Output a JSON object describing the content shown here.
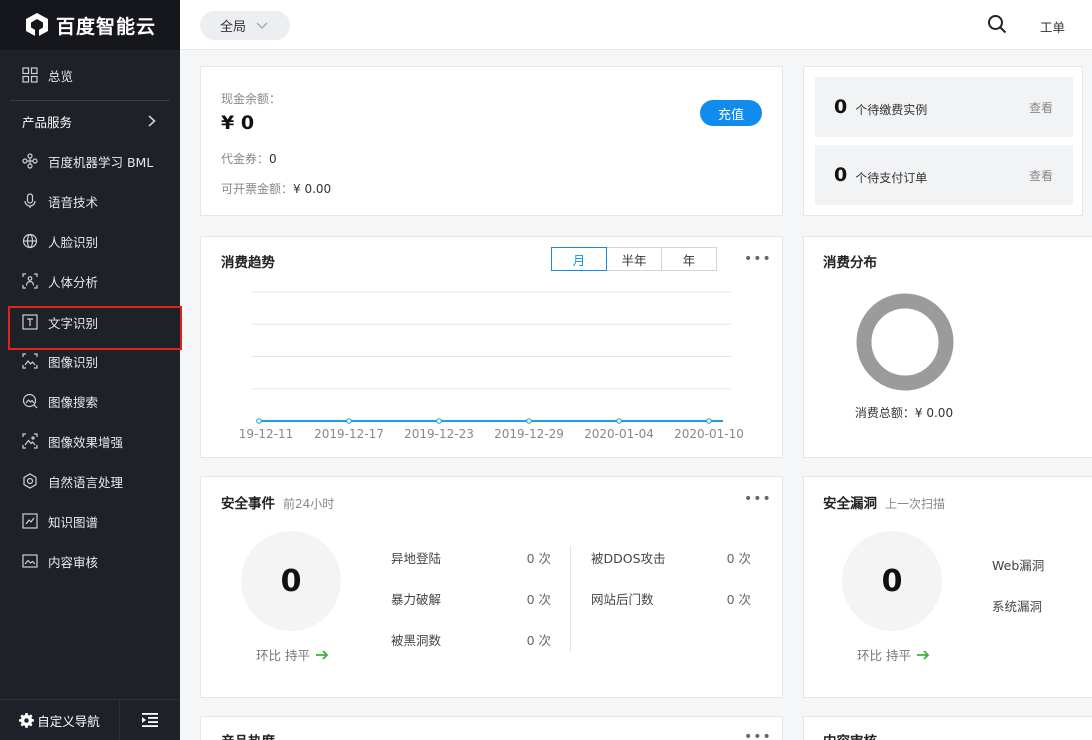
{
  "brand": {
    "name": "百度智能云"
  },
  "sidebar": {
    "overview": "总览",
    "section_label": "产品服务",
    "items": [
      {
        "label": "百度机器学习 BML"
      },
      {
        "label": "语音技术"
      },
      {
        "label": "人脸识别"
      },
      {
        "label": "人体分析"
      },
      {
        "label": "文字识别"
      },
      {
        "label": "图像识别"
      },
      {
        "label": "图像搜索"
      },
      {
        "label": "图像效果增强"
      },
      {
        "label": "自然语言处理"
      },
      {
        "label": "知识图谱"
      },
      {
        "label": "内容审核"
      }
    ],
    "custom_nav": "自定义导航"
  },
  "topbar": {
    "scope": "全局",
    "ticket": "工单"
  },
  "balance": {
    "label": "现金余额：",
    "value": "¥ 0",
    "voucher_label": "代金券：",
    "voucher_value": "0",
    "invoice_label": "可开票金额：",
    "invoice_value": "¥ 0.00",
    "recharge": "充值"
  },
  "pending": [
    {
      "count": "0",
      "text": "个待缴费实例",
      "action": "查看"
    },
    {
      "count": "0",
      "text": "个待支付订单",
      "action": "查看"
    }
  ],
  "trend": {
    "title": "消费趋势",
    "tabs": [
      "月",
      "半年",
      "年"
    ],
    "active_tab": "月",
    "more": "•••"
  },
  "chart_data": {
    "type": "line",
    "x": [
      "19-12-11",
      "2019-12-17",
      "2019-12-23",
      "2019-12-29",
      "2020-01-04",
      "2020-01-10"
    ],
    "series": [
      {
        "values": [
          0,
          0,
          0,
          0,
          0,
          0
        ]
      }
    ],
    "grid": true
  },
  "distribution": {
    "title": "消费分布",
    "total": "消费总额：¥ 0.00"
  },
  "security_events": {
    "title": "安全事件",
    "subtitle": "前24小时",
    "count": "0",
    "ratio": "环比 持平",
    "more": "•••",
    "items": [
      {
        "label": "异地登陆",
        "value": "0 次"
      },
      {
        "label": "暴力破解",
        "value": "0 次"
      },
      {
        "label": "被黑洞数",
        "value": "0 次"
      },
      {
        "label": "被DDOS攻击",
        "value": "0 次"
      },
      {
        "label": "网站后门数",
        "value": "0 次"
      }
    ]
  },
  "vulnerabilities": {
    "title": "安全漏洞",
    "subtitle": "上一次扫描",
    "count": "0",
    "ratio": "环比 持平",
    "items": [
      "Web漏洞",
      "系统漏洞"
    ]
  },
  "bottom": {
    "left_title": "产品热度",
    "right_title": "内容审核",
    "more": "•••"
  },
  "colors": {
    "sidebar_bg": "#1f2128",
    "accent": "#108cee",
    "highlight": "#e0241c",
    "chart_line": "#1a9ee6",
    "up_arrow": "#3fae3f"
  }
}
